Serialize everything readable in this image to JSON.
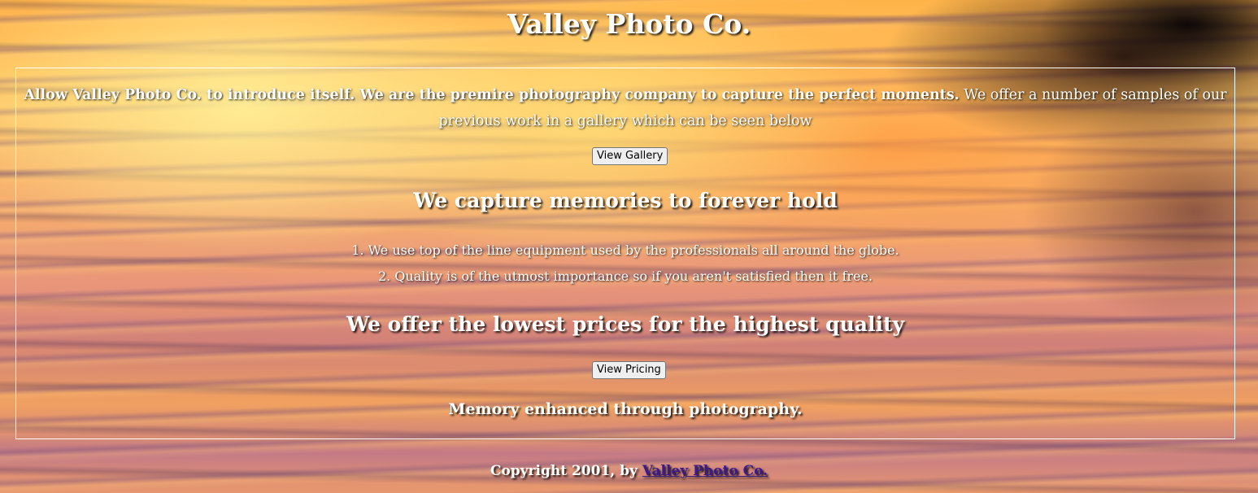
{
  "header": {
    "title": "Valley Photo Co."
  },
  "intro": {
    "bold_text": "Allow Valley Photo Co. to introduce itself. We are the premire photography company to capture the perfect moments.",
    "regular_text": " We offer a number of samples of our previous work in a gallery which can be seen below"
  },
  "buttons": {
    "gallery_label": "View Gallery",
    "pricing_label": "View Pricing"
  },
  "sections": {
    "memories_heading": "We capture memories to forever hold",
    "features": [
      "1. We use top of the line equipment used by the professionals all around the globe.",
      "2. Quality is of the utmost importance so if you aren't satisfied then it free."
    ],
    "prices_heading": "We offer the lowest prices for the highest quality",
    "tagline": "Memory enhanced through photography."
  },
  "footer": {
    "copyright_text": "Copyright 2001, by ",
    "link_text": "Valley Photo Co."
  },
  "colors": {
    "text": "#ffffff",
    "box_border": "#ffffff",
    "link": "#3a1a8c",
    "button_bg": "#efefef"
  }
}
